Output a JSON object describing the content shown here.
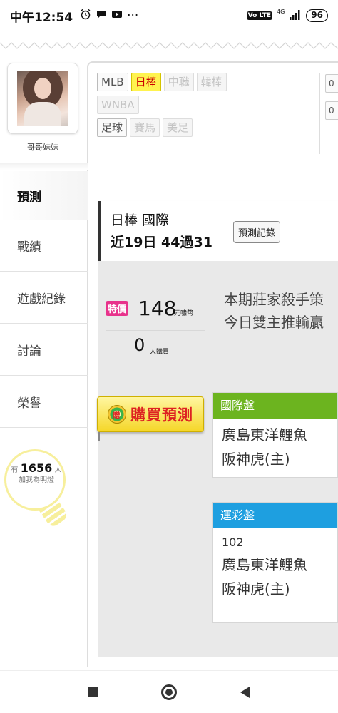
{
  "status_bar": {
    "time": "中午12:54",
    "network": "4G",
    "volte": "Vo LTE",
    "battery": "96"
  },
  "profile": {
    "username": "哥哥妹妹"
  },
  "nav": {
    "items": [
      {
        "label": "預測",
        "active": true
      },
      {
        "label": "戰績"
      },
      {
        "label": "遊戲紀錄"
      },
      {
        "label": "討論"
      },
      {
        "label": "榮譽"
      }
    ]
  },
  "followers": {
    "prefix": "有",
    "count": "1656",
    "suffix": "人",
    "line2": "加我為明燈"
  },
  "league_tags": {
    "row1": [
      {
        "label": "MLB",
        "state": "normal"
      },
      {
        "label": "日棒",
        "state": "selected"
      },
      {
        "label": "中職",
        "state": "disabled"
      },
      {
        "label": "韓棒",
        "state": "disabled"
      }
    ],
    "row2": [
      {
        "label": "WNBA",
        "state": "disabled"
      }
    ],
    "row3": [
      {
        "label": "足球",
        "state": "normal"
      },
      {
        "label": "賽馬",
        "state": "disabled"
      },
      {
        "label": "美足",
        "state": "disabled"
      }
    ],
    "side": [
      "0",
      "0"
    ]
  },
  "league_header": {
    "title": "日棒 國際",
    "record": "近19日 44過31",
    "record_button": "預測記錄"
  },
  "offer": {
    "special_label": "特價",
    "price": "148",
    "price_unit": "元嘯幣",
    "buyers": "0",
    "buyers_unit": "人購買",
    "buy_button": "購買預測",
    "gift_icon_text": "贈"
  },
  "notice": {
    "line1": "本期莊家殺手策",
    "line2": "今日雙主推輸贏"
  },
  "cards": [
    {
      "header": "國際盤",
      "color": "#6cb41f",
      "code": "",
      "team1": "廣島東洋鯉魚",
      "team2": "阪神虎(主)"
    },
    {
      "header": "運彩盤",
      "color": "#1e9fe0",
      "code": "102",
      "team1": "廣島東洋鯉魚",
      "team2": "阪神虎(主)"
    }
  ]
}
